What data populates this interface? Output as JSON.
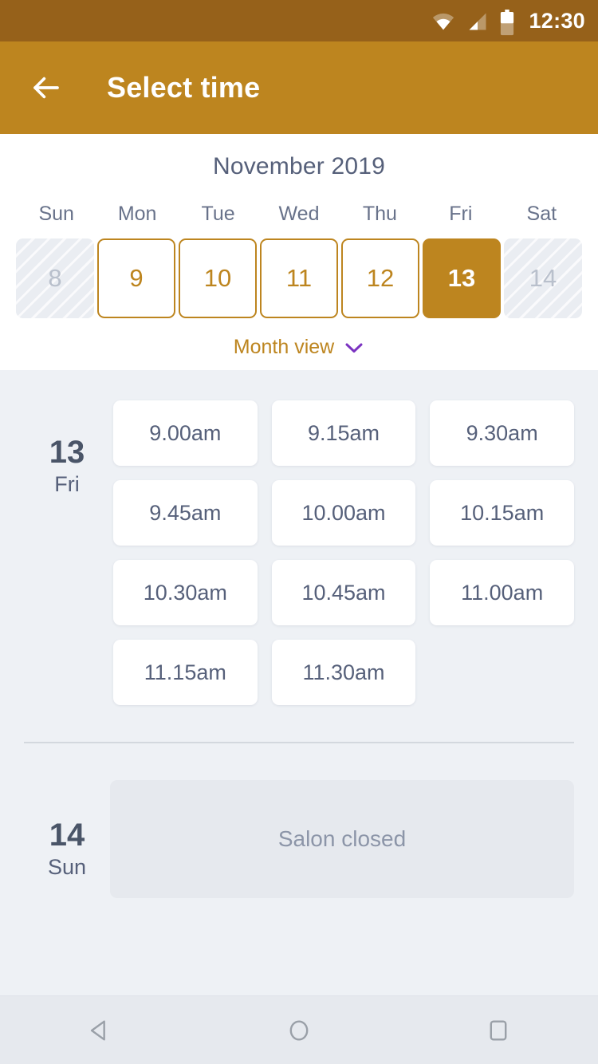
{
  "status_bar": {
    "time": "12:30",
    "icons": [
      "wifi-icon",
      "signal-icon",
      "battery-icon"
    ]
  },
  "app_bar": {
    "back_icon": "back-arrow-icon",
    "title": "Select time"
  },
  "calendar": {
    "month_title": "November 2019",
    "weekdays": [
      "Sun",
      "Mon",
      "Tue",
      "Wed",
      "Thu",
      "Fri",
      "Sat"
    ],
    "days": [
      {
        "number": "8",
        "state": "disabled"
      },
      {
        "number": "9",
        "state": "available"
      },
      {
        "number": "10",
        "state": "available"
      },
      {
        "number": "11",
        "state": "available"
      },
      {
        "number": "12",
        "state": "available"
      },
      {
        "number": "13",
        "state": "selected"
      },
      {
        "number": "14",
        "state": "disabled"
      }
    ],
    "month_view_label": "Month view",
    "month_view_chevron": "chevron-down-icon"
  },
  "schedule": [
    {
      "day_number": "13",
      "day_name": "Fri",
      "closed": false,
      "closed_label": "",
      "slots": [
        "9.00am",
        "9.15am",
        "9.30am",
        "9.45am",
        "10.00am",
        "10.15am",
        "10.30am",
        "10.45am",
        "11.00am",
        "11.15am",
        "11.30am"
      ]
    },
    {
      "day_number": "14",
      "day_name": "Sun",
      "closed": true,
      "closed_label": "Salon closed",
      "slots": []
    }
  ],
  "nav_bar": {
    "back": "nav-back-icon",
    "home": "nav-home-icon",
    "recents": "nav-recents-icon"
  },
  "colors": {
    "status_bar": "#96611a",
    "app_bar_gold": "#bd851f",
    "accent_gold": "#bd851f",
    "chevron_purple": "#7b33c1",
    "page_bg": "#eef1f5",
    "slate_text": "#56607a",
    "muted_text": "#8c95a8",
    "closed_bg": "#e6e9ee",
    "divider": "#d3d8de"
  }
}
